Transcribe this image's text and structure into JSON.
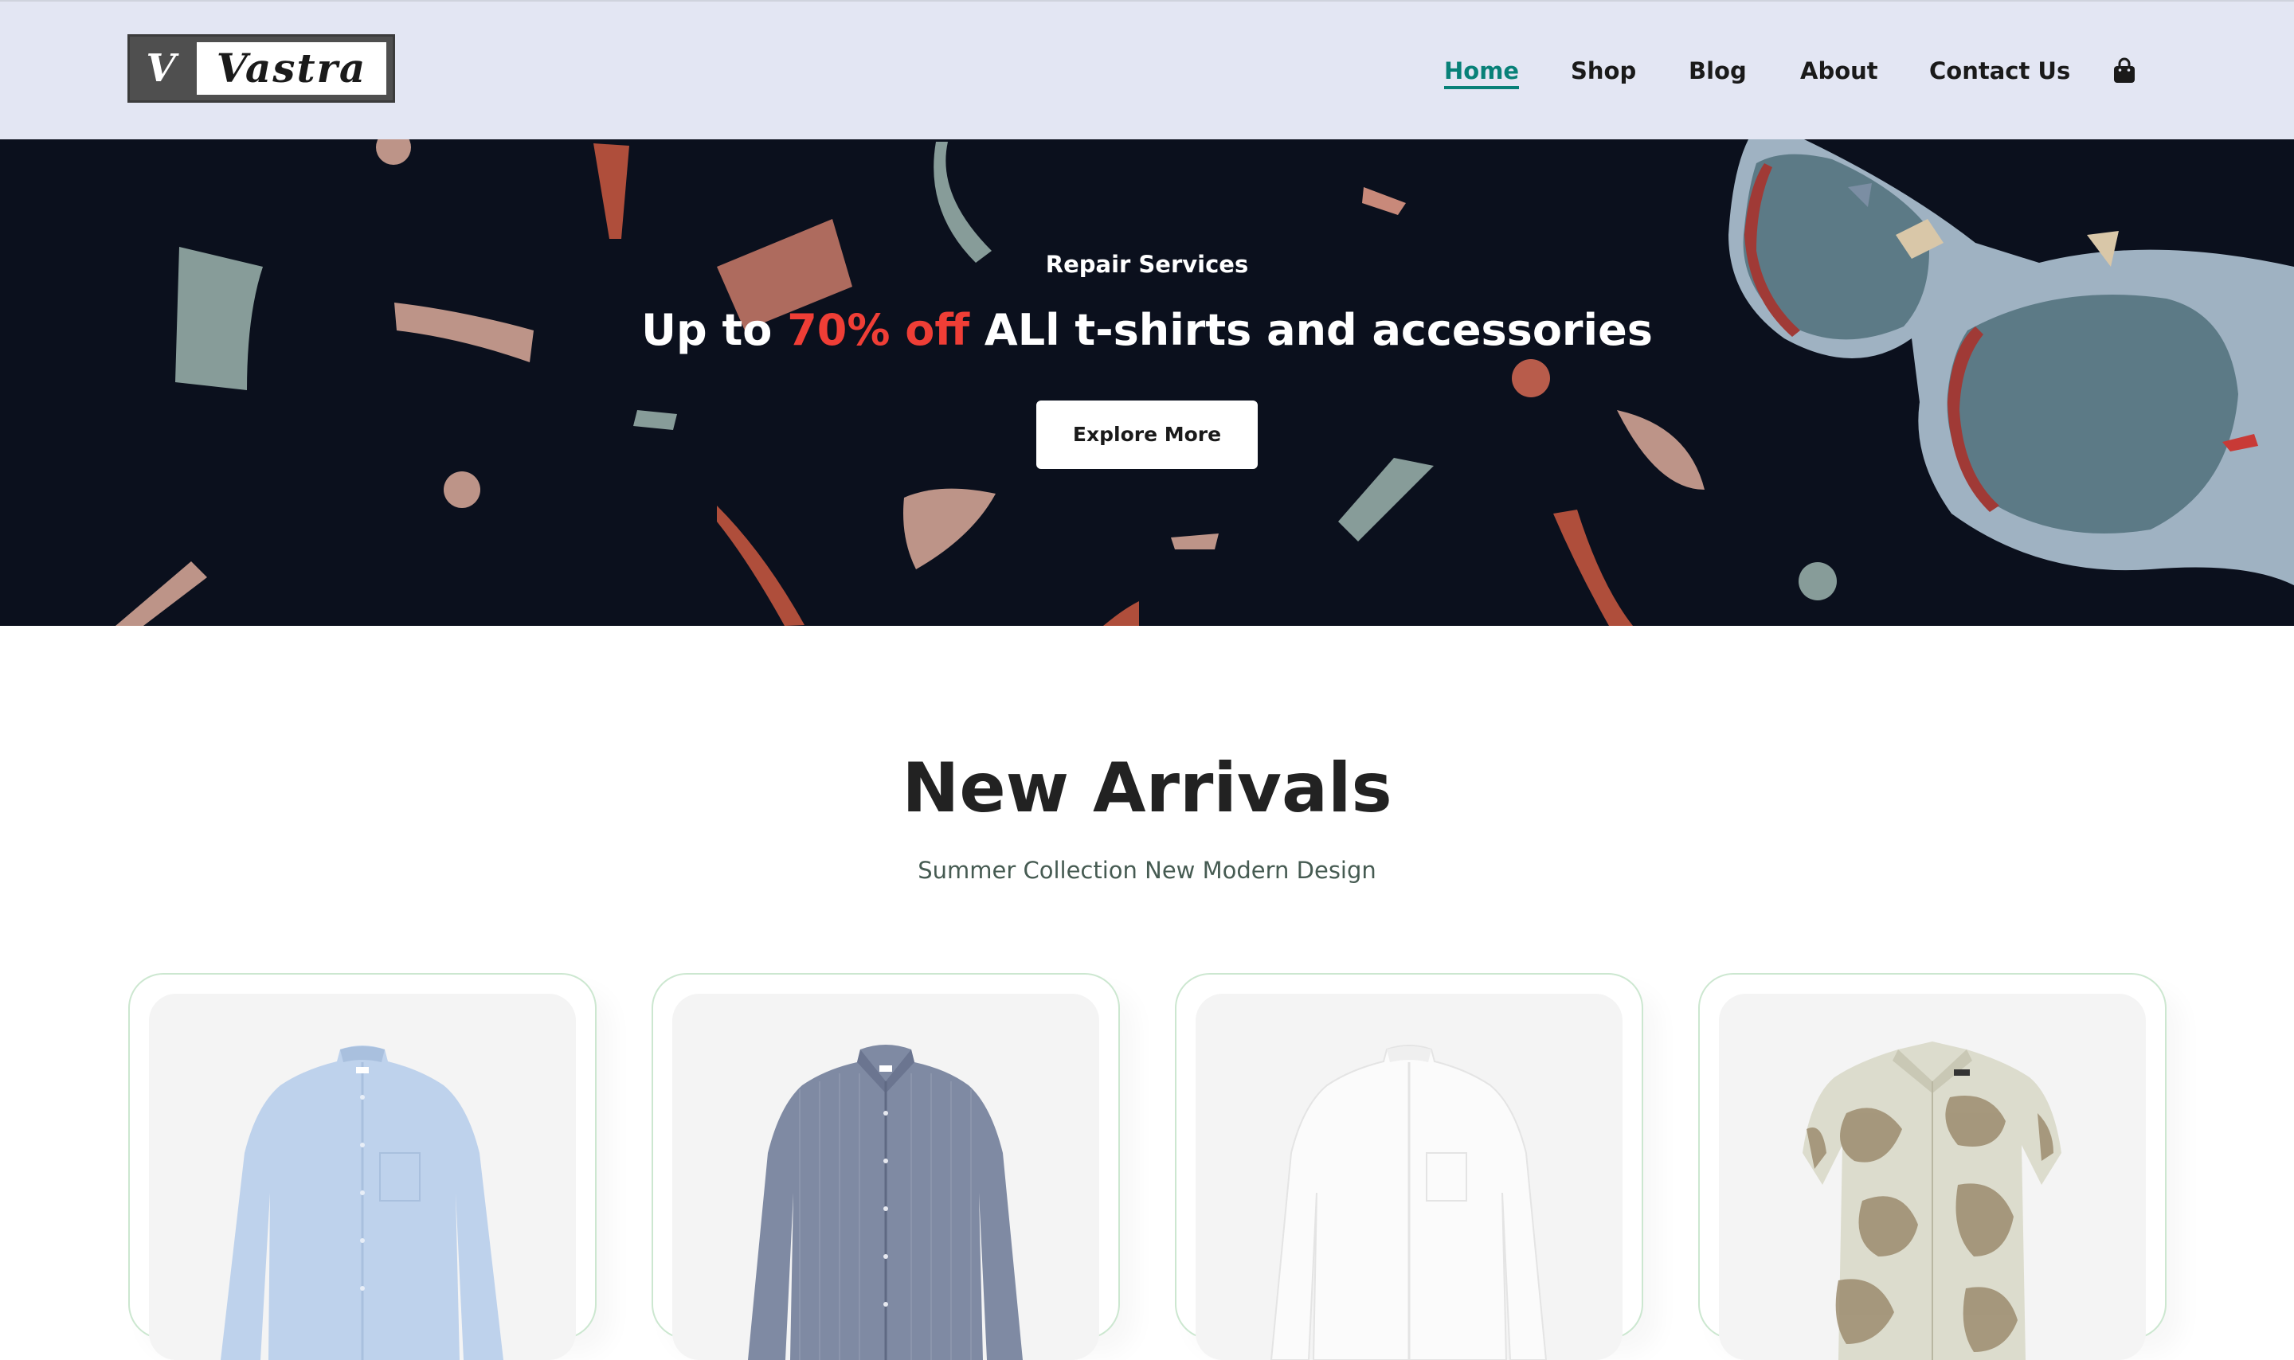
{
  "header": {
    "logo": {
      "initial": "V",
      "name": "Vastra"
    },
    "nav": [
      {
        "label": "Home",
        "active": true
      },
      {
        "label": "Shop",
        "active": false
      },
      {
        "label": "Blog",
        "active": false
      },
      {
        "label": "About",
        "active": false
      },
      {
        "label": "Contact Us",
        "active": false
      }
    ],
    "cart_icon": "shopping-bag-icon"
  },
  "hero": {
    "kicker": "Repair Services",
    "title_prefix": "Up to",
    "title_accent": "70% off",
    "title_suffix": "ALl t-shirts and accessories",
    "button_label": "Explore More",
    "image": "sunglasses"
  },
  "arrivals": {
    "title": "New Arrivals",
    "subtitle": "Summer Collection New Modern Design",
    "products": [
      {
        "image": "light-blue-shirt"
      },
      {
        "image": "grey-striped-shirt"
      },
      {
        "image": "white-shirt"
      },
      {
        "image": "floral-print-shirt"
      }
    ]
  },
  "colors": {
    "header_bg": "#e3e6f3",
    "hero_bg": "#0b101d",
    "accent": "#088178",
    "sale_red": "#ef3e36",
    "card_border": "#cce7d0"
  }
}
